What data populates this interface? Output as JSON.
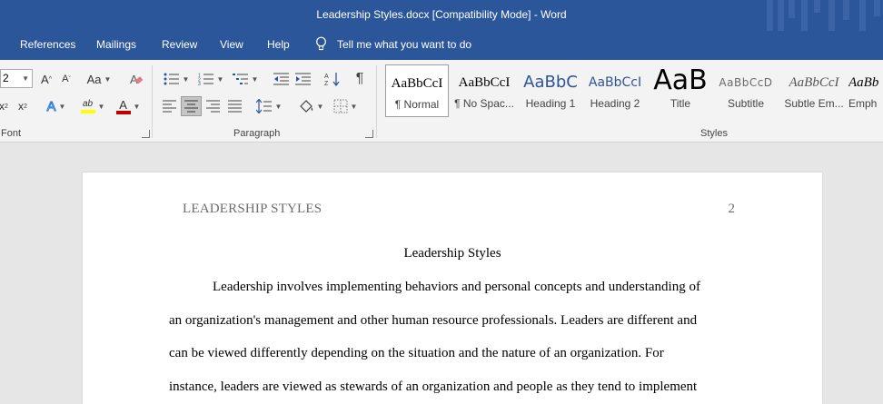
{
  "window": {
    "title": "Leadership Styles.docx  [Compatibility Mode]  -  Word"
  },
  "menu": {
    "tabs": [
      "References",
      "Mailings",
      "Review",
      "View",
      "Help"
    ],
    "tell_me": "Tell me what you want to do"
  },
  "ribbon": {
    "font_size_value": "2",
    "groups": {
      "font": "Font",
      "paragraph": "Paragraph",
      "styles": "Styles"
    },
    "font_buttons": {
      "case": "Aa",
      "grow": "A",
      "shrink": "A",
      "subscript": "x",
      "superscript": "x",
      "text_effects": "A",
      "highlight": "ab",
      "font_color": "A"
    },
    "highlight_color": "#ffff00",
    "font_color_bar": "#c00000",
    "pilcrow": "¶",
    "styles": [
      {
        "preview": "AaBbCcI",
        "name": "¶ Normal",
        "selected": true
      },
      {
        "preview": "AaBbCcI",
        "name": "¶ No Spac...",
        "selected": false
      },
      {
        "preview": "AaBbC",
        "name": "Heading 1",
        "selected": false
      },
      {
        "preview": "AaBbCcI",
        "name": "Heading 2",
        "selected": false
      },
      {
        "preview": "AaB",
        "name": "Title",
        "selected": false
      },
      {
        "preview": "AaBbCcD",
        "name": "Subtitle",
        "selected": false
      },
      {
        "preview": "AaBbCcI",
        "name": "Subtle Em...",
        "selected": false
      },
      {
        "preview": "AaBb",
        "name": "Emph",
        "selected": false
      }
    ]
  },
  "document": {
    "header_left": "LEADERSHIP STYLES",
    "header_right": "2",
    "title": "Leadership Styles",
    "lines": [
      "Leadership involves implementing behaviors and personal concepts and understanding of",
      "an organization's management and other human resource professionals. Leaders are different and",
      "can be viewed differently depending on the situation and the nature of an organization. For",
      "instance, leaders are viewed as stewards of an organization and people as they tend to implement"
    ]
  },
  "colors": {
    "accent": "#2b579a",
    "ribbon_bg": "#f3f3f3",
    "canvas_bg": "#e6e6e6"
  }
}
